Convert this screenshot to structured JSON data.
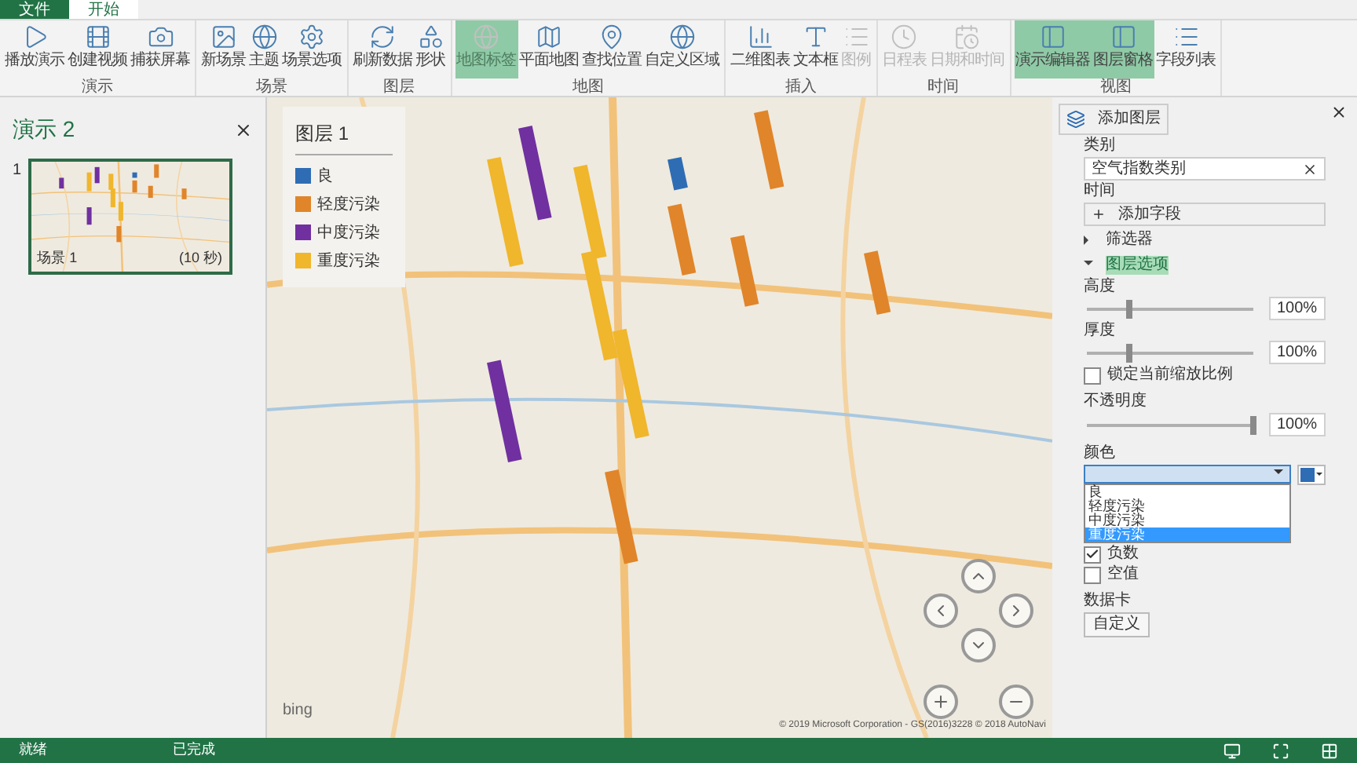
{
  "file_tabs": [
    {
      "label": "文件",
      "selected": false
    },
    {
      "label": "开始",
      "selected": true
    }
  ],
  "ribbon_groups": [
    {
      "title": "演示",
      "buttons": [
        {
          "label": "播放演示",
          "selected": false,
          "disabled": false
        },
        {
          "label": "创建视频",
          "selected": false,
          "disabled": false
        },
        {
          "label": "捕获屏幕",
          "selected": false,
          "disabled": false
        }
      ]
    },
    {
      "title": "场景",
      "buttons": [
        {
          "label": "新场景",
          "selected": false,
          "disabled": false
        },
        {
          "label": "主题",
          "selected": false,
          "disabled": false
        },
        {
          "label": "场景选项",
          "selected": false,
          "disabled": false
        }
      ]
    },
    {
      "title": "图层",
      "buttons": [
        {
          "label": "刷新数据",
          "selected": false,
          "disabled": false
        },
        {
          "label": "形状",
          "selected": false,
          "disabled": false
        }
      ]
    },
    {
      "title": "地图",
      "buttons": [
        {
          "label": "地图标签",
          "selected": true,
          "disabled": true
        },
        {
          "label": "平面地图",
          "selected": false,
          "disabled": false
        },
        {
          "label": "查找位置",
          "selected": false,
          "disabled": false
        },
        {
          "label": "自定义区域",
          "selected": false,
          "disabled": false
        }
      ]
    },
    {
      "title": "插入",
      "buttons": [
        {
          "label": "二维图表",
          "selected": false,
          "disabled": false
        },
        {
          "label": "文本框",
          "selected": false,
          "disabled": false
        },
        {
          "label": "图例",
          "selected": false,
          "disabled": true
        }
      ]
    },
    {
      "title": "时间",
      "buttons": [
        {
          "label": "日程表",
          "selected": false,
          "disabled": true
        },
        {
          "label": "日期和时间",
          "selected": false,
          "disabled": true
        }
      ]
    },
    {
      "title": "视图",
      "buttons": [
        {
          "label": "演示编辑器",
          "selected": true,
          "disabled": false
        },
        {
          "label": "图层窗格",
          "selected": true,
          "disabled": false
        },
        {
          "label": "字段列表",
          "selected": false,
          "disabled": false
        }
      ]
    }
  ],
  "tour_panel": {
    "title": "演示 2",
    "scenes": [
      {
        "number": "1",
        "name": "场景 1",
        "duration": "(10 秒)",
        "selected": true
      }
    ]
  },
  "legend": {
    "title": "图层 1",
    "items": [
      {
        "label": "良",
        "color": "#2e6db4"
      },
      {
        "label": "轻度污染",
        "color": "#e0852a"
      },
      {
        "label": "中度污染",
        "color": "#7030a0"
      },
      {
        "label": "重度污染",
        "color": "#f0b62c"
      }
    ]
  },
  "map": {
    "logo": "bing",
    "copyright": "© 2019 Microsoft Corporation - GS(2016)3228 © 2018 AutoNavi"
  },
  "layer_pane": {
    "add_layer": "添加图层",
    "category_label": "类别",
    "category_value": "空气指数类别",
    "time_label": "时间",
    "add_field": "添加字段",
    "sections": [
      {
        "label": "筛选器",
        "expanded": false
      },
      {
        "label": "图层选项",
        "expanded": true
      }
    ],
    "sliders": [
      {
        "label": "高度",
        "level": 0.25,
        "reading": "100%"
      },
      {
        "label": "厚度",
        "level": 0.25,
        "reading": "100%"
      }
    ],
    "lock_scale": {
      "label": "锁定当前缩放比例",
      "checked": false
    },
    "opacity": {
      "label": "不透明度",
      "level": 1,
      "reading": "100%"
    },
    "color_label": "颜色",
    "color_options": [
      {
        "label": "良",
        "selected": false
      },
      {
        "label": "轻度污染",
        "selected": false
      },
      {
        "label": "中度污染",
        "selected": false
      },
      {
        "label": "重度污染",
        "selected": true
      }
    ],
    "checkboxes": [
      {
        "label": "负数",
        "checked": true
      },
      {
        "label": "空值",
        "checked": false
      }
    ],
    "data_card_label": "数据卡",
    "customize": "自定义"
  },
  "status_bar": {
    "left": "就绪",
    "middle": "已完成"
  }
}
